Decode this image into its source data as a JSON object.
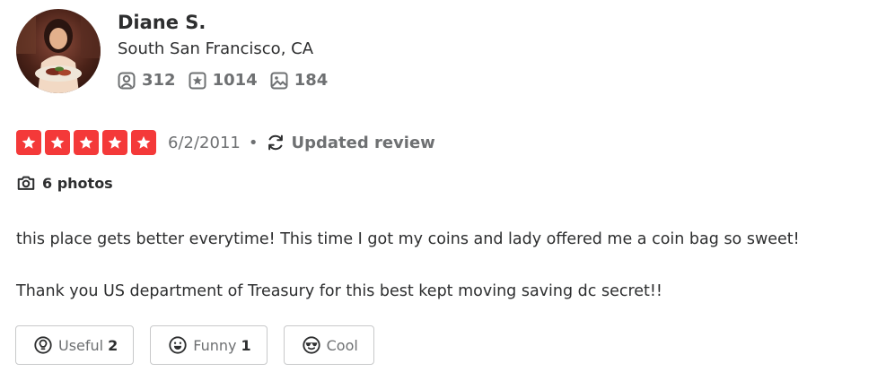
{
  "user": {
    "name": "Diane S.",
    "location": "South San Francisco, CA",
    "stats": {
      "friends": "312",
      "reviews": "1014",
      "photos": "184"
    }
  },
  "review": {
    "rating": 5,
    "date": "6/2/2011",
    "separator": "•",
    "updated_label": "Updated review",
    "photos_label": "6 photos",
    "paragraphs": [
      "this place gets better everytime! This time I got my coins and lady offered me a coin bag so sweet!",
      "Thank you US department of Treasury for this best kept moving saving dc secret!!"
    ]
  },
  "reactions": {
    "useful": {
      "label": "Useful",
      "count": "2"
    },
    "funny": {
      "label": "Funny",
      "count": "1"
    },
    "cool": {
      "label": "Cool",
      "count": ""
    }
  },
  "colors": {
    "star_red": "#f43939",
    "text_dark": "#2d2e2f",
    "text_gray": "#6e7072",
    "border": "#c8c9ca"
  },
  "icons": {
    "friends": "friends-icon",
    "reviews": "review-star-icon",
    "photos": "photo-icon",
    "updated": "refresh-icon",
    "camera": "camera-icon",
    "useful": "lightbulb-icon",
    "funny": "smile-icon",
    "cool": "sunglasses-icon"
  }
}
